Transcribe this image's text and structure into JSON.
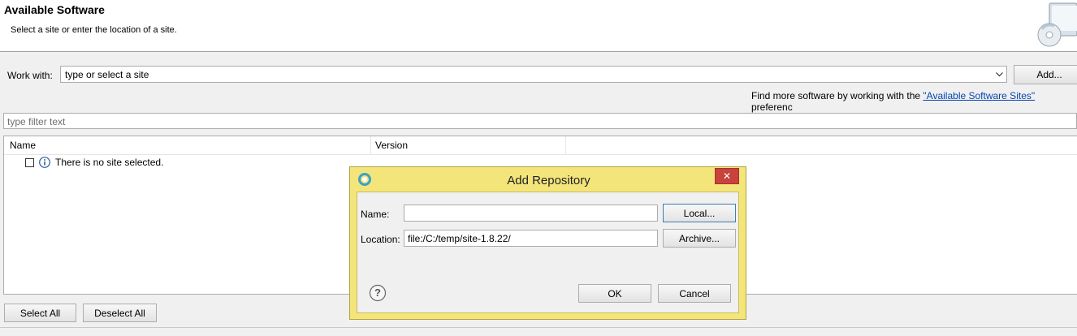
{
  "header": {
    "title": "Available Software",
    "description": "Select a site or enter the location of a site."
  },
  "work_with": {
    "label": "Work with:",
    "value": "type or select a site",
    "add_button": "Add...",
    "find_more_prefix": "Find more software by working with the ",
    "find_more_link": "\"Available Software Sites\"",
    "find_more_suffix": " preferenc"
  },
  "filter": {
    "placeholder": "type filter text"
  },
  "table": {
    "columns": [
      "Name",
      "Version"
    ],
    "rows": [
      {
        "text": "There is no site selected.",
        "checked": false,
        "icon": "info-icon"
      }
    ]
  },
  "footer": {
    "select_all": "Select All",
    "deselect_all": "Deselect All"
  },
  "dialog": {
    "title": "Add Repository",
    "name_label": "Name:",
    "name_value": "",
    "location_label": "Location:",
    "location_value": "file:/C:/temp/site-1.8.22/",
    "local_button": "Local...",
    "archive_button": "Archive...",
    "ok_button": "OK",
    "cancel_button": "Cancel",
    "close_symbol": "✕",
    "help_symbol": "?"
  },
  "colors": {
    "dialog_frame": "#f4e57b",
    "close_button": "#c7433b",
    "link": "#0645ad"
  }
}
